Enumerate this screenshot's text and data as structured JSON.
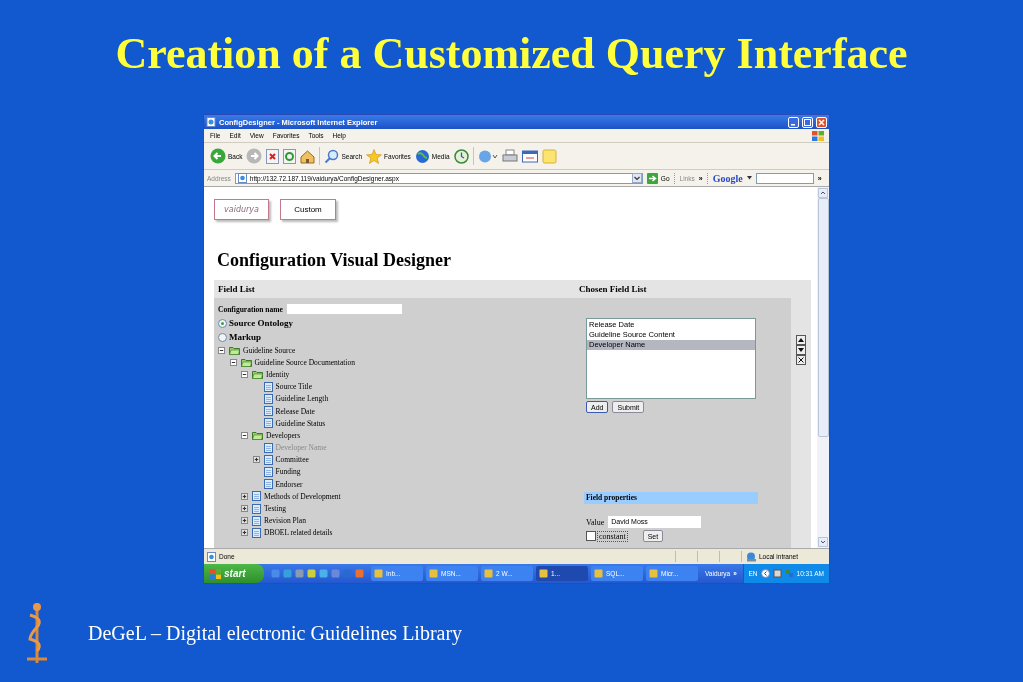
{
  "slide": {
    "title": "Creation of a Customized Query Interface",
    "footer": "DeGeL – Digital electronic Guidelines Library"
  },
  "browser": {
    "title": "ConfigDesigner - Microsoft Internet Explorer",
    "menu": [
      "File",
      "Edit",
      "View",
      "Favorites",
      "Tools",
      "Help"
    ],
    "toolbar": [
      {
        "kind": "back",
        "label": "Back"
      },
      {
        "kind": "forward"
      },
      {
        "kind": "stop"
      },
      {
        "kind": "refresh"
      },
      {
        "kind": "home"
      },
      {
        "kind": "separator"
      },
      {
        "kind": "search",
        "label": "Search"
      },
      {
        "kind": "favorites",
        "label": "Favorites"
      },
      {
        "kind": "media",
        "label": "Media"
      },
      {
        "kind": "history"
      },
      {
        "kind": "separator"
      },
      {
        "kind": "mail"
      },
      {
        "kind": "print"
      },
      {
        "kind": "edit"
      },
      {
        "kind": "notes"
      }
    ],
    "address": {
      "label": "Address",
      "url": "http://132.72.187.119/vaidurya/ConfigDesigner.aspx",
      "go": "Go"
    },
    "links": "Links",
    "links_more": "»",
    "google": "Google",
    "more": "»",
    "status": {
      "text": "Done",
      "zone": "Local intranet"
    }
  },
  "page": {
    "logo": "vaidurya",
    "tab": "Custom",
    "heading": "Configuration Visual Designer",
    "field_list": {
      "title": "Field List",
      "config_label": "Configuration name",
      "modes": [
        {
          "label": "Source Ontology",
          "selected": true
        },
        {
          "label": "Markup",
          "selected": false
        }
      ],
      "tree": [
        {
          "label": "Guideline Source",
          "kind": "folder",
          "expanded": true,
          "disabled": false,
          "children": [
            {
              "label": "Guideline Source Documentation",
              "kind": "folder",
              "expanded": true,
              "disabled": false,
              "children": [
                {
                  "label": "Identity",
                  "kind": "folder",
                  "expanded": true,
                  "disabled": false,
                  "children": [
                    {
                      "label": "Source Title",
                      "kind": "field",
                      "disabled": false
                    },
                    {
                      "label": "Guideline Length",
                      "kind": "field",
                      "disabled": false
                    },
                    {
                      "label": "Release Date",
                      "kind": "field",
                      "disabled": false
                    },
                    {
                      "label": "Guideline Status",
                      "kind": "field",
                      "disabled": false
                    }
                  ]
                },
                {
                  "label": "Developers",
                  "kind": "folder",
                  "expanded": true,
                  "disabled": false,
                  "children": [
                    {
                      "label": "Developer Name",
                      "kind": "field",
                      "disabled": true
                    },
                    {
                      "label": "Committee",
                      "kind": "field",
                      "expanded": false,
                      "disabled": false
                    },
                    {
                      "label": "Funding",
                      "kind": "field",
                      "disabled": false
                    },
                    {
                      "label": "Endorser",
                      "kind": "field",
                      "disabled": false
                    }
                  ]
                },
                {
                  "label": "Methods of Development",
                  "kind": "field",
                  "expanded": false,
                  "disabled": false
                },
                {
                  "label": "Testing",
                  "kind": "field",
                  "expanded": false,
                  "disabled": false
                },
                {
                  "label": "Revision Plan",
                  "kind": "field",
                  "expanded": false,
                  "disabled": false
                },
                {
                  "label": "DBOEL related details",
                  "kind": "field",
                  "expanded": false,
                  "disabled": false
                }
              ]
            }
          ]
        }
      ]
    },
    "chosen": {
      "title": "Chosen Field List",
      "items": [
        {
          "label": "Release Date",
          "selected": false
        },
        {
          "label": "Guideline Source Content",
          "selected": false
        },
        {
          "label": "Developer Name",
          "selected": true
        }
      ],
      "buttons": [
        "Add",
        "Submit"
      ],
      "properties": {
        "title": "Field properties",
        "value_label": "Value",
        "value": "David Moss",
        "constant": {
          "label": "constant",
          "checked": false
        },
        "set": "Set"
      }
    }
  },
  "taskbar": {
    "start": "start",
    "tasks": [
      {
        "label": "Inb...",
        "selected": false
      },
      {
        "label": "MSN...",
        "selected": false
      },
      {
        "label": "2 W...",
        "selected": false
      },
      {
        "label": "1...",
        "selected": true
      },
      {
        "label": "SQL...",
        "selected": false
      },
      {
        "label": "Micr...",
        "selected": false
      }
    ],
    "toolbar": "Vaidurya",
    "more": "»",
    "language": "EN",
    "clock": "10:31 AM"
  }
}
